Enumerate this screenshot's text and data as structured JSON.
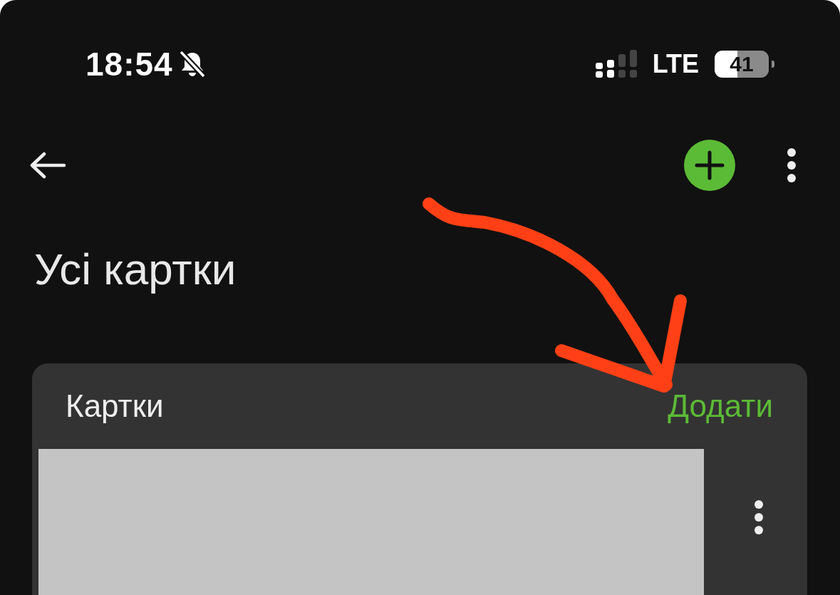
{
  "status_bar": {
    "time": "18:54",
    "network": "LTE",
    "battery": "41"
  },
  "title": "Усі картки",
  "section": {
    "title": "Картки",
    "action": "Додати"
  }
}
